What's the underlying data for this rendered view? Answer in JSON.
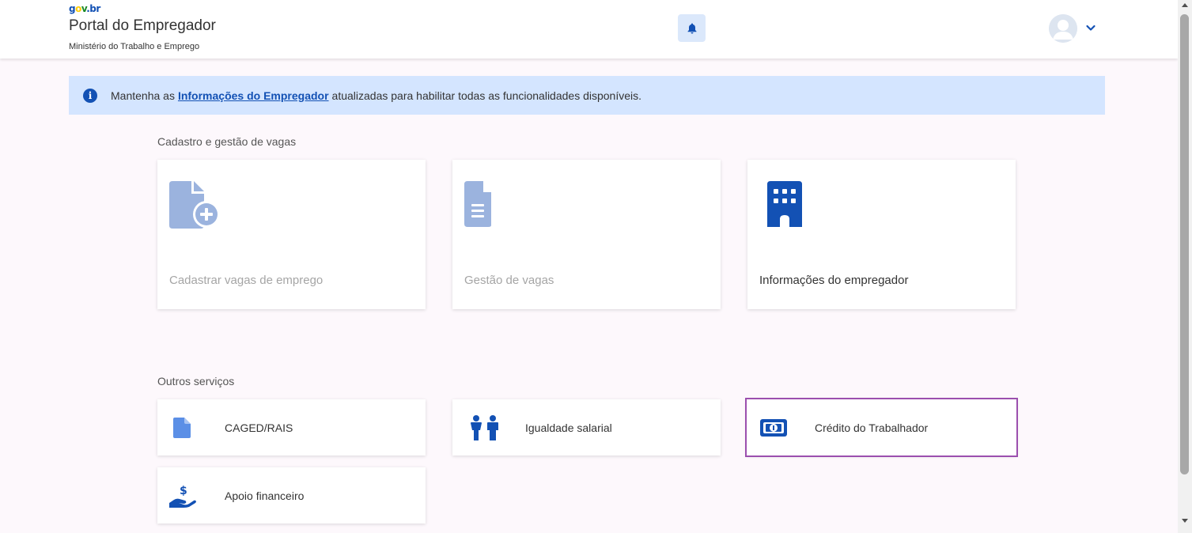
{
  "header": {
    "logo": {
      "g": "g",
      "o": "o",
      "v": "v",
      "b": ".br"
    },
    "title": "Portal do Empregador",
    "subtitle": "Ministério do Trabalho e Emprego",
    "notification_icon": "bell-icon",
    "avatar_icon": "user-avatar-icon",
    "menu_icon": "chevron-down-icon"
  },
  "alert": {
    "icon": "info-icon",
    "icon_glyph": "i",
    "text_before": "Mantenha as",
    "link_text": "Informações do Empregador",
    "text_after": "atualizadas para habilitar todas as funcionalidades disponíveis."
  },
  "sections": {
    "cadastro": {
      "title": "Cadastro e gestão de vagas",
      "cards": [
        {
          "label": "Cadastrar vagas de emprego",
          "icon": "file-add-icon",
          "enabled": false
        },
        {
          "label": "Gestão de vagas",
          "icon": "file-lines-icon",
          "enabled": false
        },
        {
          "label": "Informações do empregador",
          "icon": "building-icon",
          "enabled": true
        }
      ]
    },
    "outros": {
      "title": "Outros serviços",
      "cards": [
        {
          "label": "CAGED/RAIS",
          "icon": "file-icon"
        },
        {
          "label": "Igualdade salarial",
          "icon": "people-icon"
        },
        {
          "label": "Crédito do Trabalhador",
          "icon": "money-bill-icon",
          "highlighted": true
        },
        {
          "label": "Apoio financeiro",
          "icon": "hand-dollar-icon"
        }
      ]
    }
  },
  "colors": {
    "primary": "#1351b4",
    "icon_light": "#6b9ae8",
    "icon_disabled": "#9bb3de",
    "alert_bg": "#d4e5ff",
    "highlight": "#9b4fae",
    "page_bg": "#fdf8fc"
  }
}
